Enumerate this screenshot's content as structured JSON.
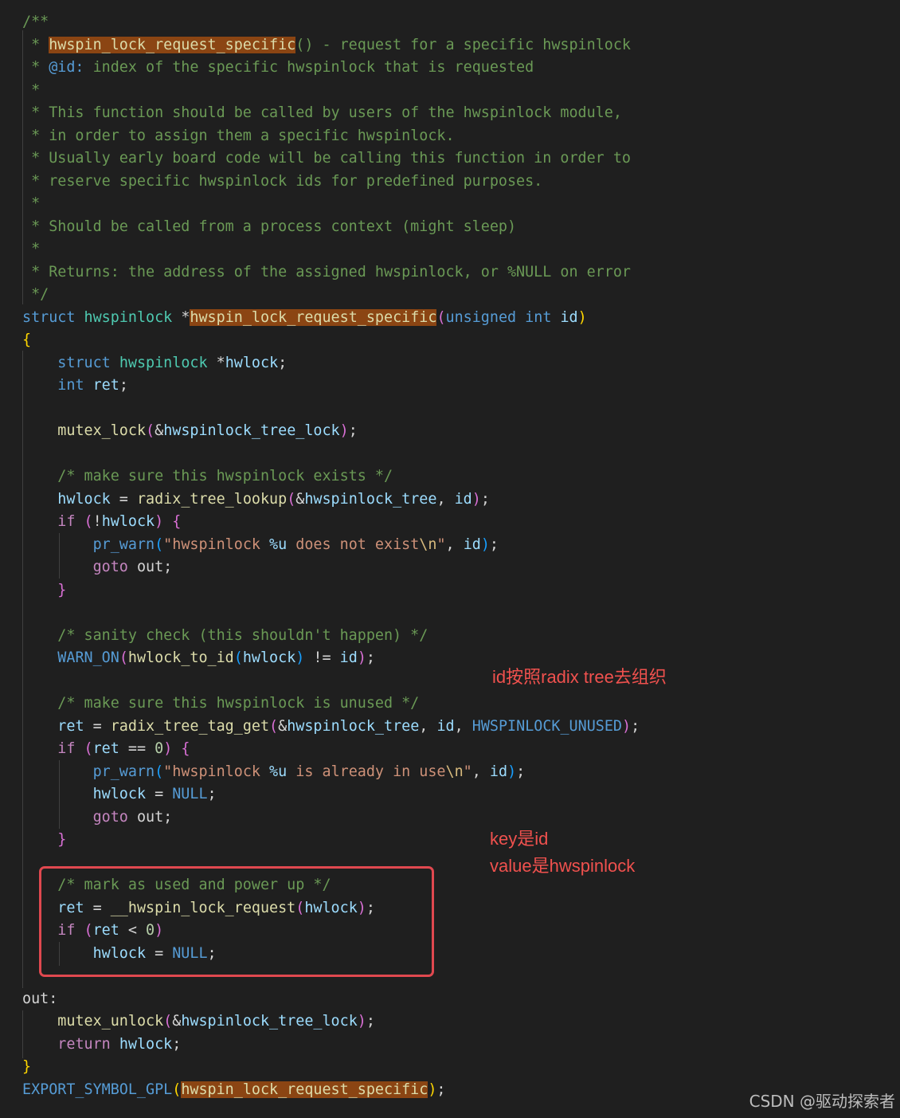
{
  "editor": {
    "lines": [
      {
        "tokens": [
          {
            "t": "/**",
            "c": "comment"
          }
        ]
      },
      {
        "tokens": [
          {
            "t": " * ",
            "c": "comment"
          },
          {
            "t": "hwspin_lock_request_specific",
            "c": "func",
            "hl": true
          },
          {
            "t": "() - request for a specific hwspinlock",
            "c": "comment"
          }
        ]
      },
      {
        "tokens": [
          {
            "t": " * ",
            "c": "comment"
          },
          {
            "t": "@id:",
            "c": "keyword"
          },
          {
            "t": " index of the specific hwspinlock that is requested",
            "c": "comment"
          }
        ]
      },
      {
        "tokens": [
          {
            "t": " *",
            "c": "comment"
          }
        ]
      },
      {
        "tokens": [
          {
            "t": " * This function should be called by users of the hwspinlock module,",
            "c": "comment"
          }
        ]
      },
      {
        "tokens": [
          {
            "t": " * in order to assign them a specific hwspinlock.",
            "c": "comment"
          }
        ]
      },
      {
        "tokens": [
          {
            "t": " * Usually early board code will be calling this function in order to",
            "c": "comment"
          }
        ]
      },
      {
        "tokens": [
          {
            "t": " * reserve specific hwspinlock ids for predefined purposes.",
            "c": "comment"
          }
        ]
      },
      {
        "tokens": [
          {
            "t": " *",
            "c": "comment"
          }
        ]
      },
      {
        "tokens": [
          {
            "t": " * Should be called from a process context (might sleep)",
            "c": "comment"
          }
        ]
      },
      {
        "tokens": [
          {
            "t": " *",
            "c": "comment"
          }
        ]
      },
      {
        "tokens": [
          {
            "t": " * Returns: the address of the assigned hwspinlock, or %NULL on error",
            "c": "comment"
          }
        ]
      },
      {
        "tokens": [
          {
            "t": " */",
            "c": "comment"
          }
        ]
      },
      {
        "tokens": [
          {
            "t": "struct",
            "c": "keyword"
          },
          {
            "t": " ",
            "c": "plain"
          },
          {
            "t": "hwspinlock",
            "c": "type"
          },
          {
            "t": " *",
            "c": "plain"
          },
          {
            "t": "hwspin_lock_request_specific",
            "c": "func",
            "hl": true
          },
          {
            "t": "(",
            "c": "brace2"
          },
          {
            "t": "unsigned",
            "c": "keyword"
          },
          {
            "t": " ",
            "c": "plain"
          },
          {
            "t": "int",
            "c": "keyword"
          },
          {
            "t": " ",
            "c": "plain"
          },
          {
            "t": "id",
            "c": "var"
          },
          {
            "t": ")",
            "c": "brace1"
          }
        ]
      },
      {
        "tokens": [
          {
            "t": "{",
            "c": "brace1"
          }
        ]
      },
      {
        "tokens": [
          {
            "t": "    ",
            "c": "plain"
          },
          {
            "t": "struct",
            "c": "keyword"
          },
          {
            "t": " ",
            "c": "plain"
          },
          {
            "t": "hwspinlock",
            "c": "type"
          },
          {
            "t": " *",
            "c": "plain"
          },
          {
            "t": "hwlock",
            "c": "var"
          },
          {
            "t": ";",
            "c": "plain"
          }
        ]
      },
      {
        "tokens": [
          {
            "t": "    ",
            "c": "plain"
          },
          {
            "t": "int",
            "c": "keyword"
          },
          {
            "t": " ",
            "c": "plain"
          },
          {
            "t": "ret",
            "c": "var"
          },
          {
            "t": ";",
            "c": "plain"
          }
        ]
      },
      {
        "tokens": []
      },
      {
        "tokens": [
          {
            "t": "    ",
            "c": "plain"
          },
          {
            "t": "mutex_lock",
            "c": "func"
          },
          {
            "t": "(",
            "c": "brace2"
          },
          {
            "t": "&",
            "c": "plain"
          },
          {
            "t": "hwspinlock_tree_lock",
            "c": "var"
          },
          {
            "t": ")",
            "c": "brace2"
          },
          {
            "t": ";",
            "c": "plain"
          }
        ]
      },
      {
        "tokens": []
      },
      {
        "tokens": [
          {
            "t": "    ",
            "c": "plain"
          },
          {
            "t": "/* make sure this hwspinlock exists */",
            "c": "comment"
          }
        ]
      },
      {
        "tokens": [
          {
            "t": "    ",
            "c": "plain"
          },
          {
            "t": "hwlock",
            "c": "var"
          },
          {
            "t": " = ",
            "c": "plain"
          },
          {
            "t": "radix_tree_lookup",
            "c": "func"
          },
          {
            "t": "(",
            "c": "brace2"
          },
          {
            "t": "&",
            "c": "plain"
          },
          {
            "t": "hwspinlock_tree",
            "c": "var"
          },
          {
            "t": ", ",
            "c": "plain"
          },
          {
            "t": "id",
            "c": "var"
          },
          {
            "t": ")",
            "c": "brace2"
          },
          {
            "t": ";",
            "c": "plain"
          }
        ]
      },
      {
        "tokens": [
          {
            "t": "    ",
            "c": "plain"
          },
          {
            "t": "if",
            "c": "control"
          },
          {
            "t": " ",
            "c": "plain"
          },
          {
            "t": "(",
            "c": "brace2"
          },
          {
            "t": "!",
            "c": "plain"
          },
          {
            "t": "hwlock",
            "c": "var"
          },
          {
            "t": ")",
            "c": "brace2"
          },
          {
            "t": " ",
            "c": "plain"
          },
          {
            "t": "{",
            "c": "brace2"
          }
        ]
      },
      {
        "tokens": [
          {
            "t": "        ",
            "c": "plain"
          },
          {
            "t": "pr_warn",
            "c": "macro"
          },
          {
            "t": "(",
            "c": "brace3"
          },
          {
            "t": "\"hwspinlock ",
            "c": "string"
          },
          {
            "t": "%u",
            "c": "var"
          },
          {
            "t": " does not exist",
            "c": "string"
          },
          {
            "t": "\\n",
            "c": "escape"
          },
          {
            "t": "\"",
            "c": "string"
          },
          {
            "t": ", ",
            "c": "plain"
          },
          {
            "t": "id",
            "c": "var"
          },
          {
            "t": ")",
            "c": "brace3"
          },
          {
            "t": ";",
            "c": "plain"
          }
        ]
      },
      {
        "tokens": [
          {
            "t": "        ",
            "c": "plain"
          },
          {
            "t": "goto",
            "c": "control"
          },
          {
            "t": " ",
            "c": "plain"
          },
          {
            "t": "out",
            "c": "plain"
          },
          {
            "t": ";",
            "c": "plain"
          }
        ]
      },
      {
        "tokens": [
          {
            "t": "    ",
            "c": "plain"
          },
          {
            "t": "}",
            "c": "brace2"
          }
        ]
      },
      {
        "tokens": []
      },
      {
        "tokens": [
          {
            "t": "    ",
            "c": "plain"
          },
          {
            "t": "/* sanity check (this shouldn't happen) */",
            "c": "comment"
          }
        ]
      },
      {
        "tokens": [
          {
            "t": "    ",
            "c": "plain"
          },
          {
            "t": "WARN_ON",
            "c": "macro"
          },
          {
            "t": "(",
            "c": "brace2"
          },
          {
            "t": "hwlock_to_id",
            "c": "func"
          },
          {
            "t": "(",
            "c": "brace3"
          },
          {
            "t": "hwlock",
            "c": "var"
          },
          {
            "t": ")",
            "c": "brace3"
          },
          {
            "t": " != ",
            "c": "plain"
          },
          {
            "t": "id",
            "c": "var"
          },
          {
            "t": ")",
            "c": "brace2"
          },
          {
            "t": ";",
            "c": "plain"
          }
        ]
      },
      {
        "tokens": []
      },
      {
        "tokens": [
          {
            "t": "    ",
            "c": "plain"
          },
          {
            "t": "/* make sure this hwspinlock is unused */",
            "c": "comment"
          }
        ]
      },
      {
        "tokens": [
          {
            "t": "    ",
            "c": "plain"
          },
          {
            "t": "ret",
            "c": "var"
          },
          {
            "t": " = ",
            "c": "plain"
          },
          {
            "t": "radix_tree_tag_get",
            "c": "func"
          },
          {
            "t": "(",
            "c": "brace2"
          },
          {
            "t": "&",
            "c": "plain"
          },
          {
            "t": "hwspinlock_tree",
            "c": "var"
          },
          {
            "t": ", ",
            "c": "plain"
          },
          {
            "t": "id",
            "c": "var"
          },
          {
            "t": ", ",
            "c": "plain"
          },
          {
            "t": "HWSPINLOCK_UNUSED",
            "c": "constant"
          },
          {
            "t": ")",
            "c": "brace2"
          },
          {
            "t": ";",
            "c": "plain"
          }
        ]
      },
      {
        "tokens": [
          {
            "t": "    ",
            "c": "plain"
          },
          {
            "t": "if",
            "c": "control"
          },
          {
            "t": " ",
            "c": "plain"
          },
          {
            "t": "(",
            "c": "brace2"
          },
          {
            "t": "ret",
            "c": "var"
          },
          {
            "t": " == ",
            "c": "plain"
          },
          {
            "t": "0",
            "c": "number"
          },
          {
            "t": ")",
            "c": "brace2"
          },
          {
            "t": " ",
            "c": "plain"
          },
          {
            "t": "{",
            "c": "brace2"
          }
        ]
      },
      {
        "tokens": [
          {
            "t": "        ",
            "c": "plain"
          },
          {
            "t": "pr_warn",
            "c": "macro"
          },
          {
            "t": "(",
            "c": "brace3"
          },
          {
            "t": "\"hwspinlock ",
            "c": "string"
          },
          {
            "t": "%u",
            "c": "var"
          },
          {
            "t": " is already in use",
            "c": "string"
          },
          {
            "t": "\\n",
            "c": "escape"
          },
          {
            "t": "\"",
            "c": "string"
          },
          {
            "t": ", ",
            "c": "plain"
          },
          {
            "t": "id",
            "c": "var"
          },
          {
            "t": ")",
            "c": "brace3"
          },
          {
            "t": ";",
            "c": "plain"
          }
        ]
      },
      {
        "tokens": [
          {
            "t": "        ",
            "c": "plain"
          },
          {
            "t": "hwlock",
            "c": "var"
          },
          {
            "t": " = ",
            "c": "plain"
          },
          {
            "t": "NULL",
            "c": "constant"
          },
          {
            "t": ";",
            "c": "plain"
          }
        ]
      },
      {
        "tokens": [
          {
            "t": "        ",
            "c": "plain"
          },
          {
            "t": "goto",
            "c": "control"
          },
          {
            "t": " ",
            "c": "plain"
          },
          {
            "t": "out",
            "c": "plain"
          },
          {
            "t": ";",
            "c": "plain"
          }
        ]
      },
      {
        "tokens": [
          {
            "t": "    ",
            "c": "plain"
          },
          {
            "t": "}",
            "c": "brace2"
          }
        ]
      },
      {
        "tokens": []
      },
      {
        "tokens": [
          {
            "t": "    ",
            "c": "plain"
          },
          {
            "t": "/* mark as used and power up */",
            "c": "comment"
          }
        ]
      },
      {
        "tokens": [
          {
            "t": "    ",
            "c": "plain"
          },
          {
            "t": "ret",
            "c": "var"
          },
          {
            "t": " = ",
            "c": "plain"
          },
          {
            "t": "__hwspin_lock_request",
            "c": "func"
          },
          {
            "t": "(",
            "c": "brace2"
          },
          {
            "t": "hwlock",
            "c": "var"
          },
          {
            "t": ")",
            "c": "brace2"
          },
          {
            "t": ";",
            "c": "plain"
          }
        ]
      },
      {
        "tokens": [
          {
            "t": "    ",
            "c": "plain"
          },
          {
            "t": "if",
            "c": "control"
          },
          {
            "t": " ",
            "c": "plain"
          },
          {
            "t": "(",
            "c": "brace2"
          },
          {
            "t": "ret",
            "c": "var"
          },
          {
            "t": " < ",
            "c": "plain"
          },
          {
            "t": "0",
            "c": "number"
          },
          {
            "t": ")",
            "c": "brace2"
          }
        ]
      },
      {
        "tokens": [
          {
            "t": "        ",
            "c": "plain"
          },
          {
            "t": "hwlock",
            "c": "var"
          },
          {
            "t": " = ",
            "c": "plain"
          },
          {
            "t": "NULL",
            "c": "constant"
          },
          {
            "t": ";",
            "c": "plain"
          }
        ]
      },
      {
        "tokens": []
      },
      {
        "tokens": [
          {
            "t": "out:",
            "c": "plain"
          }
        ]
      },
      {
        "tokens": [
          {
            "t": "    ",
            "c": "plain"
          },
          {
            "t": "mutex_unlock",
            "c": "func"
          },
          {
            "t": "(",
            "c": "brace2"
          },
          {
            "t": "&",
            "c": "plain"
          },
          {
            "t": "hwspinlock_tree_lock",
            "c": "var"
          },
          {
            "t": ")",
            "c": "brace2"
          },
          {
            "t": ";",
            "c": "plain"
          }
        ]
      },
      {
        "tokens": [
          {
            "t": "    ",
            "c": "plain"
          },
          {
            "t": "return",
            "c": "control"
          },
          {
            "t": " ",
            "c": "plain"
          },
          {
            "t": "hwlock",
            "c": "var"
          },
          {
            "t": ";",
            "c": "plain"
          }
        ]
      },
      {
        "tokens": [
          {
            "t": "}",
            "c": "brace1"
          }
        ]
      },
      {
        "tokens": [
          {
            "t": "EXPORT_SYMBOL_GPL",
            "c": "macro"
          },
          {
            "t": "(",
            "c": "brace1"
          },
          {
            "t": "hwspin_lock_request_specific",
            "c": "func",
            "hl": true
          },
          {
            "t": ")",
            "c": "brace1"
          },
          {
            "t": ";",
            "c": "plain"
          }
        ]
      }
    ]
  },
  "annotations": {
    "note_radix": "id按照radix tree去组织",
    "note_key": "key是id",
    "note_value": "value是hwspinlock"
  },
  "watermark": "CSDN @驱动探索者",
  "colors": {
    "background": "#1f1f1f",
    "highlight_box_border": "#e0484f",
    "annotation_text": "#f0514e",
    "token_highlight": "#8b4513"
  }
}
